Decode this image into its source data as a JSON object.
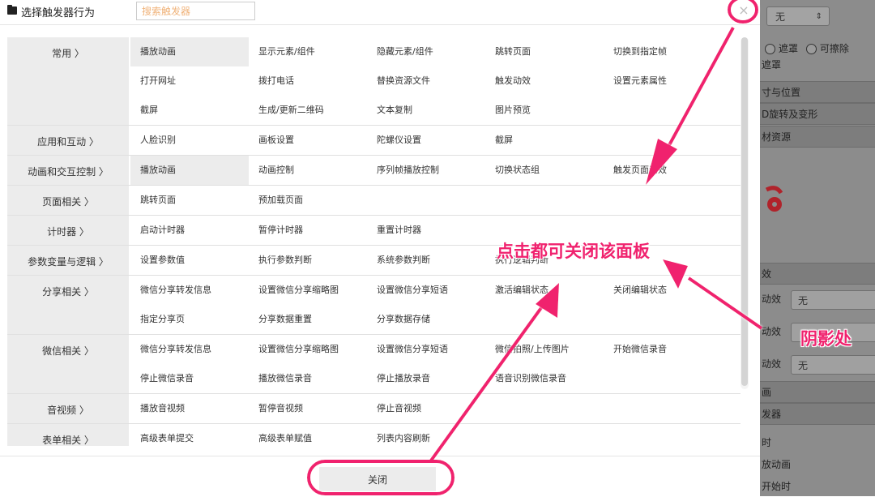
{
  "modal": {
    "title": "选择触发器行为",
    "search_placeholder": "搜索触发器",
    "close_symbol": "×",
    "footer_close_label": "关闭"
  },
  "categories": [
    {
      "label": "常用 〉",
      "items": [
        "播放动画",
        "显示元素/组件",
        "隐藏元素/组件",
        "跳转页面",
        "切换到指定帧",
        "打开网址",
        "拨打电话",
        "替换资源文件",
        "触发动效",
        "设置元素属性",
        "截屏",
        "生成/更新二维码",
        "文本复制",
        "图片预览"
      ]
    },
    {
      "label": "应用和互动 〉",
      "items": [
        "人脸识别",
        "画板设置",
        "陀螺仪设置",
        "截屏"
      ]
    },
    {
      "label": "动画和交互控制 〉",
      "items": [
        "播放动画",
        "动画控制",
        "序列帧播放控制",
        "切换状态组",
        "触发页面动效"
      ]
    },
    {
      "label": "页面相关 〉",
      "items": [
        "跳转页面",
        "预加载页面"
      ]
    },
    {
      "label": "计时器 〉",
      "items": [
        "启动计时器",
        "暂停计时器",
        "重置计时器"
      ]
    },
    {
      "label": "参数变量与逻辑 〉",
      "items": [
        "设置参数值",
        "执行参数判断",
        "系统参数判断",
        "执行逻辑判断"
      ]
    },
    {
      "label": "分享相关 〉",
      "items": [
        "微信分享转发信息",
        "设置微信分享缩略图",
        "设置微信分享短语",
        "激活编辑状态",
        "关闭编辑状态",
        "指定分享页",
        "分享数据重置",
        "分享数据存储"
      ]
    },
    {
      "label": "微信相关 〉",
      "items": [
        "微信分享转发信息",
        "设置微信分享缩略图",
        "设置微信分享短语",
        "微信拍照/上传图片",
        "开始微信录音",
        "停止微信录音",
        "播放微信录音",
        "停止播放录音",
        "语音识别微信录音"
      ]
    },
    {
      "label": "音视频 〉",
      "items": [
        "播放音视频",
        "暂停音视频",
        "停止音视频"
      ]
    },
    {
      "label": "表单相关 〉",
      "items": [
        "高级表单提交",
        "高级表单赋值",
        "列表内容刷新"
      ]
    }
  ],
  "selected_items": [
    [
      0,
      0
    ],
    [
      2,
      0
    ]
  ],
  "background_panel": {
    "select_value": "无",
    "radio_labels": [
      "遮罩",
      "可擦除"
    ],
    "mask_label": "遮罩",
    "sections": [
      "寸与位置",
      "D旋转及变形",
      "材资源"
    ],
    "effect_section": "效",
    "effect_rows": [
      {
        "label": "动效",
        "value": "无"
      },
      {
        "label": "动效",
        "value": ""
      },
      {
        "label": "动效",
        "value": "无"
      }
    ],
    "lower_rows": [
      "画",
      "发器",
      "时",
      "放动画",
      "开始时"
    ]
  },
  "annotations": {
    "click_close_text": "点击都可关闭该面板",
    "shadow_text": "阴影处",
    "accent_color": "#f0226e"
  }
}
